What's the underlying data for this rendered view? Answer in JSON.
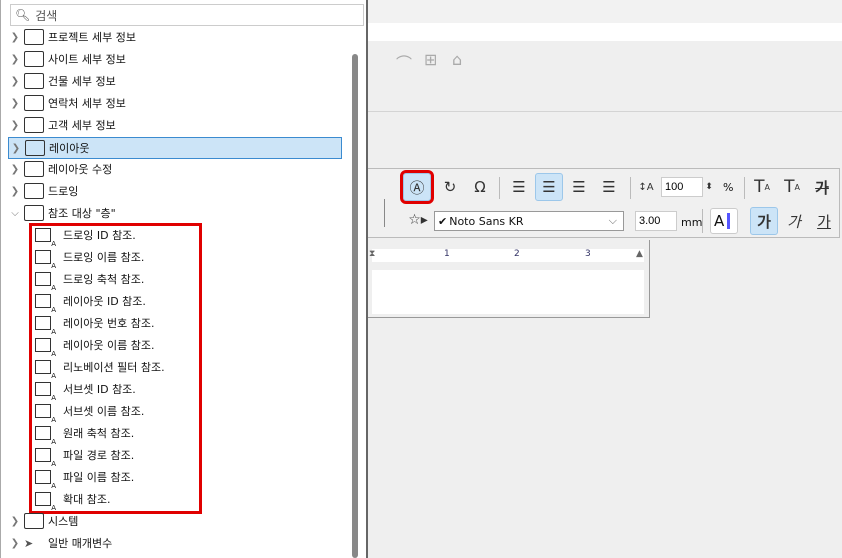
{
  "search": {
    "placeholder": "검색"
  },
  "tree": [
    {
      "label": "프로젝트 세부 정보",
      "icon": "house-icon"
    },
    {
      "label": "사이트 세부 정보",
      "icon": "map-pin-icon"
    },
    {
      "label": "건물 세부 정보",
      "icon": "building-icon"
    },
    {
      "label": "연락처 세부 정보",
      "icon": "contact-icon"
    },
    {
      "label": "고객 세부 정보",
      "icon": "client-icon"
    },
    {
      "label": "레이아웃",
      "icon": "layout-icon",
      "selected": true
    },
    {
      "label": "레이아웃 수정",
      "icon": "layout-revision-icon"
    },
    {
      "label": "드로잉",
      "icon": "drawing-icon"
    },
    {
      "label": "참조 대상 \"층\"",
      "icon": "reference-icon",
      "expanded": true
    }
  ],
  "children": [
    "드로잉 ID 참조.",
    "드로잉 이름 참조.",
    "드로잉 축척 참조.",
    "레이아웃 ID 참조.",
    "레이아웃 번호 참조.",
    "레이아웃 이름 참조.",
    "리노베이션 필터 참조.",
    "서브셋 ID 참조.",
    "서브셋 이름 참조.",
    "원래 축척 참조.",
    "파일 경로 참조.",
    "파일 이름 참조.",
    "확대 참조."
  ],
  "tree_bottom": [
    {
      "label": "시스템",
      "icon": "system-icon"
    },
    {
      "label": "일반 매개변수",
      "icon": "cursor-icon"
    }
  ],
  "toolbar": {
    "line_spacing": "100",
    "percent": "%",
    "font": "Noto Sans KR",
    "size": "3.00",
    "unit": "mm",
    "superscript": "T",
    "subscript": "T",
    "strike": "가",
    "bold": "가",
    "italic": "가",
    "underline": "가",
    "text_style": "A"
  },
  "ruler": {
    "ticks": [
      "1",
      "2",
      "3"
    ]
  },
  "colors": {
    "highlight": "#e00000",
    "selected": "#cce4f7"
  }
}
